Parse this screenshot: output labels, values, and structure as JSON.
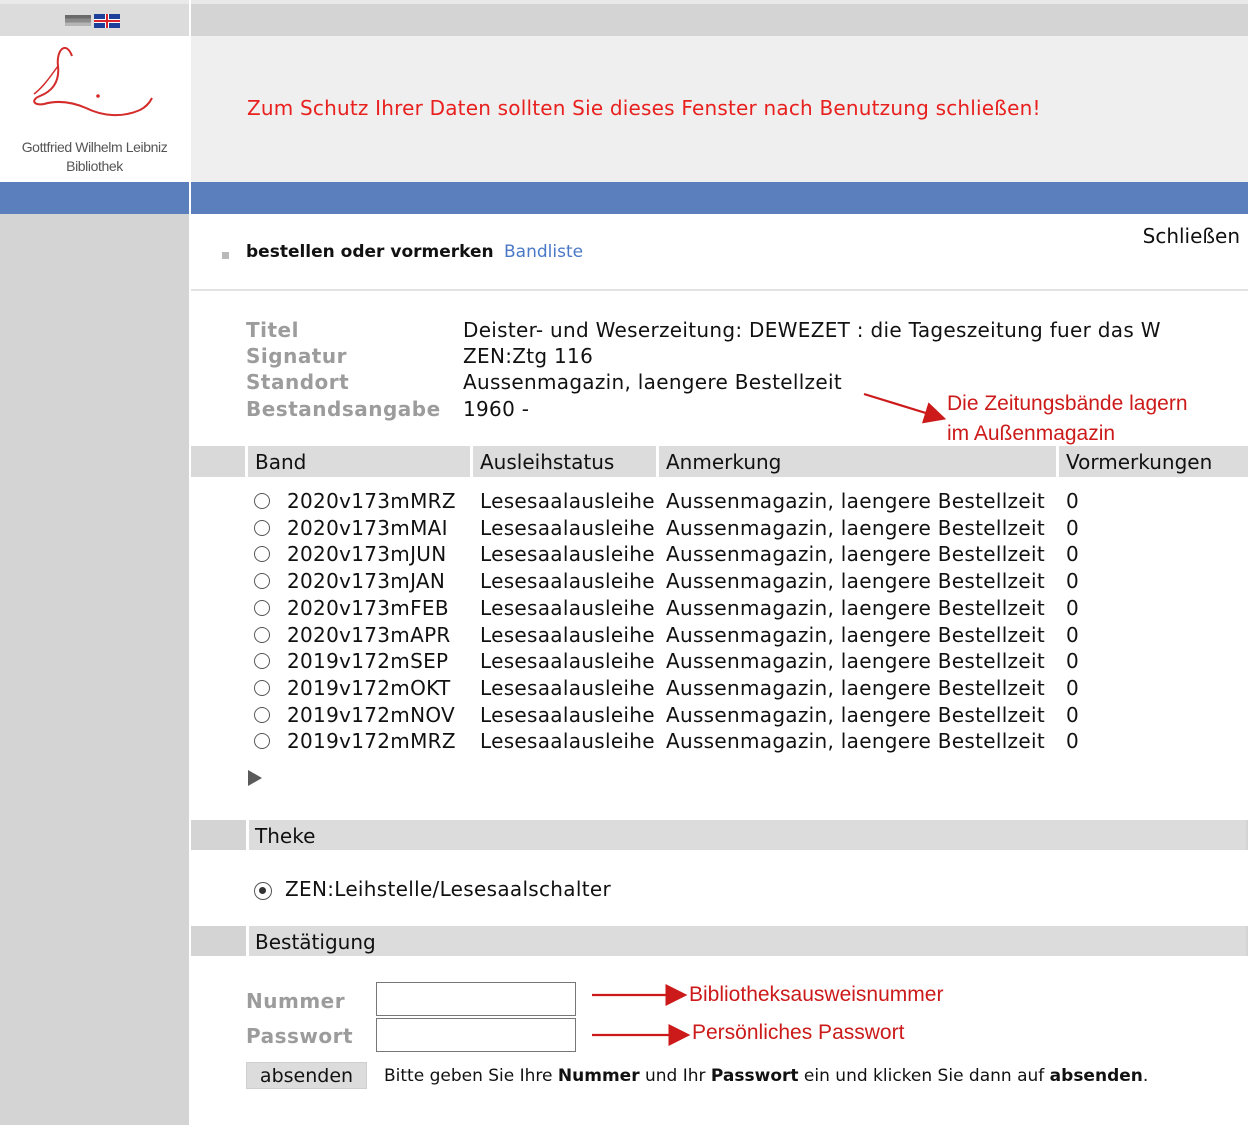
{
  "header": {
    "logo_line1": "Gottfried Wilhelm Leibniz",
    "logo_line2": "Bibliothek",
    "warning": "Zum Schutz Ihrer Daten sollten Sie dieses Fenster nach Benutzung schließen!",
    "languages": [
      "de-flag-icon",
      "uk-flag-icon"
    ]
  },
  "sidebar": {
    "close_label": "Schließen"
  },
  "action_bar": {
    "title": "bestellen oder vormerken",
    "link": "Bandliste"
  },
  "record": {
    "rows": [
      {
        "label": "Titel",
        "value": "Deister- und Weserzeitung: DEWEZET : die Tageszeitung fuer das W"
      },
      {
        "label": "Signatur",
        "value": "ZEN:Ztg 116"
      },
      {
        "label": "Standort",
        "value": "Aussenmagazin, laengere Bestellzeit"
      },
      {
        "label": "Bestandsangabe",
        "value": "1960 -"
      }
    ]
  },
  "annotations": {
    "storage_line1": "Die Zeitungsbände lagern",
    "storage_line2": "im Außenmagazin",
    "number": "Bibliotheksausweisnummer",
    "password": "Persönliches Passwort"
  },
  "table": {
    "headers": [
      "Band",
      "Ausleihstatus",
      "Anmerkung",
      "Vormerkungen"
    ],
    "rows": [
      {
        "band": "2020v173mMRZ",
        "status": "Lesesaalausleihe",
        "note": "Aussenmagazin, laengere Bestellzeit",
        "count": "0"
      },
      {
        "band": "2020v173mMAI",
        "status": "Lesesaalausleihe",
        "note": "Aussenmagazin, laengere Bestellzeit",
        "count": "0"
      },
      {
        "band": "2020v173mJUN",
        "status": "Lesesaalausleihe",
        "note": "Aussenmagazin, laengere Bestellzeit",
        "count": "0"
      },
      {
        "band": "2020v173mJAN",
        "status": "Lesesaalausleihe",
        "note": "Aussenmagazin, laengere Bestellzeit",
        "count": "0"
      },
      {
        "band": "2020v173mFEB",
        "status": "Lesesaalausleihe",
        "note": "Aussenmagazin, laengere Bestellzeit",
        "count": "0"
      },
      {
        "band": "2020v173mAPR",
        "status": "Lesesaalausleihe",
        "note": "Aussenmagazin, laengere Bestellzeit",
        "count": "0"
      },
      {
        "band": "2019v172mSEP",
        "status": "Lesesaalausleihe",
        "note": "Aussenmagazin, laengere Bestellzeit",
        "count": "0"
      },
      {
        "band": "2019v172mOKT",
        "status": "Lesesaalausleihe",
        "note": "Aussenmagazin, laengere Bestellzeit",
        "count": "0"
      },
      {
        "band": "2019v172mNOV",
        "status": "Lesesaalausleihe",
        "note": "Aussenmagazin, laengere Bestellzeit",
        "count": "0"
      },
      {
        "band": "2019v172mMRZ",
        "status": "Lesesaalausleihe",
        "note": "Aussenmagazin, laengere Bestellzeit",
        "count": "0"
      }
    ]
  },
  "theke": {
    "heading": "Theke",
    "option": "ZEN:Leihstelle/Lesesaalschalter"
  },
  "confirm": {
    "heading": "Bestätigung",
    "number_label": "Nummer",
    "password_label": "Passwort",
    "number_value": "",
    "password_value": "",
    "submit": "absenden",
    "hint_1": "Bitte geben Sie Ihre ",
    "hint_b1": "Nummer",
    "hint_2": " und Ihr ",
    "hint_b2": "Passwort",
    "hint_3": " ein und klicken Sie dann auf ",
    "hint_b3": "absenden",
    "hint_4": "."
  },
  "colors": {
    "accent_blue": "#5b7fbc",
    "warning_red": "#e8201e",
    "annotation_red": "#cc1a1a"
  }
}
